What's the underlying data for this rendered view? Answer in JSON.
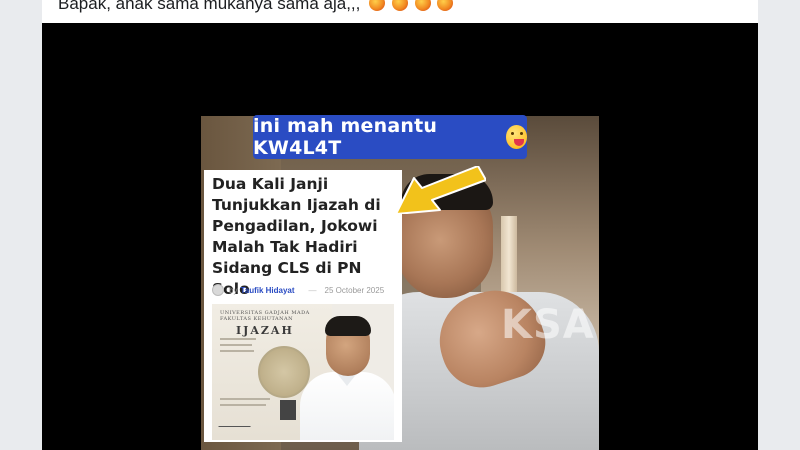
{
  "post": {
    "caption": "Bapak, anak sama mukanya sama aja,,,"
  },
  "video": {
    "overlay_text": "ini mah menantu KW4L4T",
    "watermark": "KSA",
    "article": {
      "headline": "Dua Kali Janji Tunjukkan Ijazah di Pengadilan, Jokowi Malah Tak Hadiri Sidang CLS di PN Solo",
      "by_prefix": "by",
      "author": "Taufik Hidayat",
      "date": "25 October 2025",
      "diploma": {
        "university": "UNIVERSITAS GADJAH MADA FAKULTAS KEHUTANAN",
        "title": "IJAZAH"
      }
    }
  },
  "colors": {
    "banner": "#2a4cc3",
    "arrow": "#f2c21b",
    "author_link": "#2a4cc3"
  },
  "icons": {
    "caption_emojis": [
      "angry-face-icon",
      "angry-face-icon",
      "angry-face-icon",
      "angry-face-icon"
    ],
    "banner_emoji": "winking-tongue-face-icon"
  }
}
